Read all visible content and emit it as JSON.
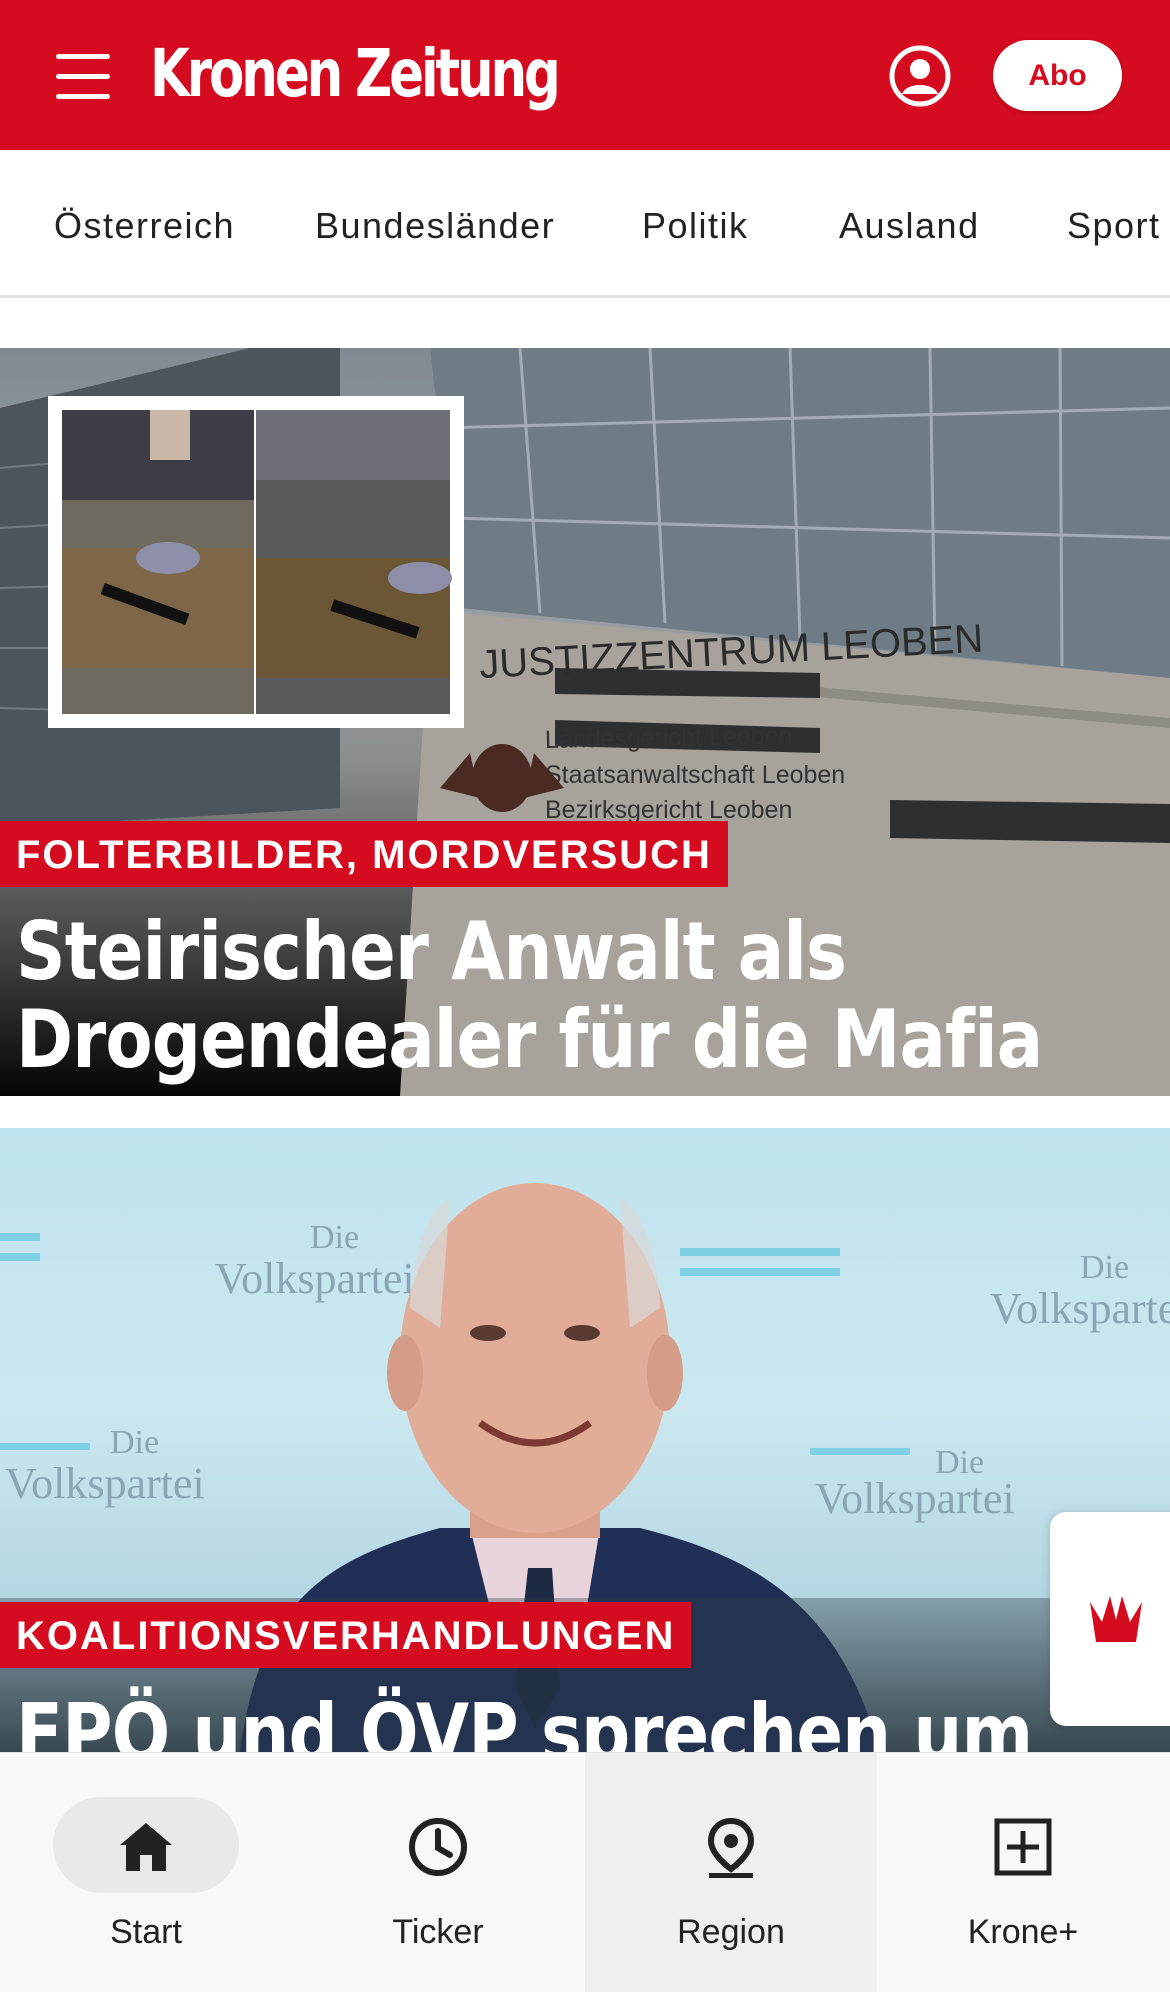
{
  "header": {
    "logo": "Kronen Zeitung",
    "abo_label": "Abo"
  },
  "categories": [
    "Österreich",
    "Bundesländer",
    "Politik",
    "Ausland",
    "Sport"
  ],
  "articles": [
    {
      "kicker": "FOLTERBILDER, MORDVERSUCH",
      "headline_line1": "Steirischer Anwalt als",
      "headline_line2": "Drogendealer für die Mafia",
      "image_text": {
        "building_sign": "JUSTIZZENTRUM LEOBEN",
        "line1": "Landesgericht Leoben",
        "line2": "Staatsanwaltschaft Leoben",
        "line3": "Bezirksgericht Leoben"
      }
    },
    {
      "kicker": "KOALITIONSVERHANDLUNGEN",
      "headline_line1": "FPÖ und ÖVP sprechen um",
      "backdrop_word_short": "Die",
      "backdrop_word": "Volkspartei"
    }
  ],
  "bottom_nav": [
    {
      "label": "Start",
      "icon": "home-icon"
    },
    {
      "label": "Ticker",
      "icon": "clock-icon"
    },
    {
      "label": "Region",
      "icon": "location-pin-icon"
    },
    {
      "label": "Krone+",
      "icon": "plus-box-icon"
    }
  ],
  "colors": {
    "brand_red": "#d50b1f",
    "nav_background": "#f8f8f8"
  }
}
